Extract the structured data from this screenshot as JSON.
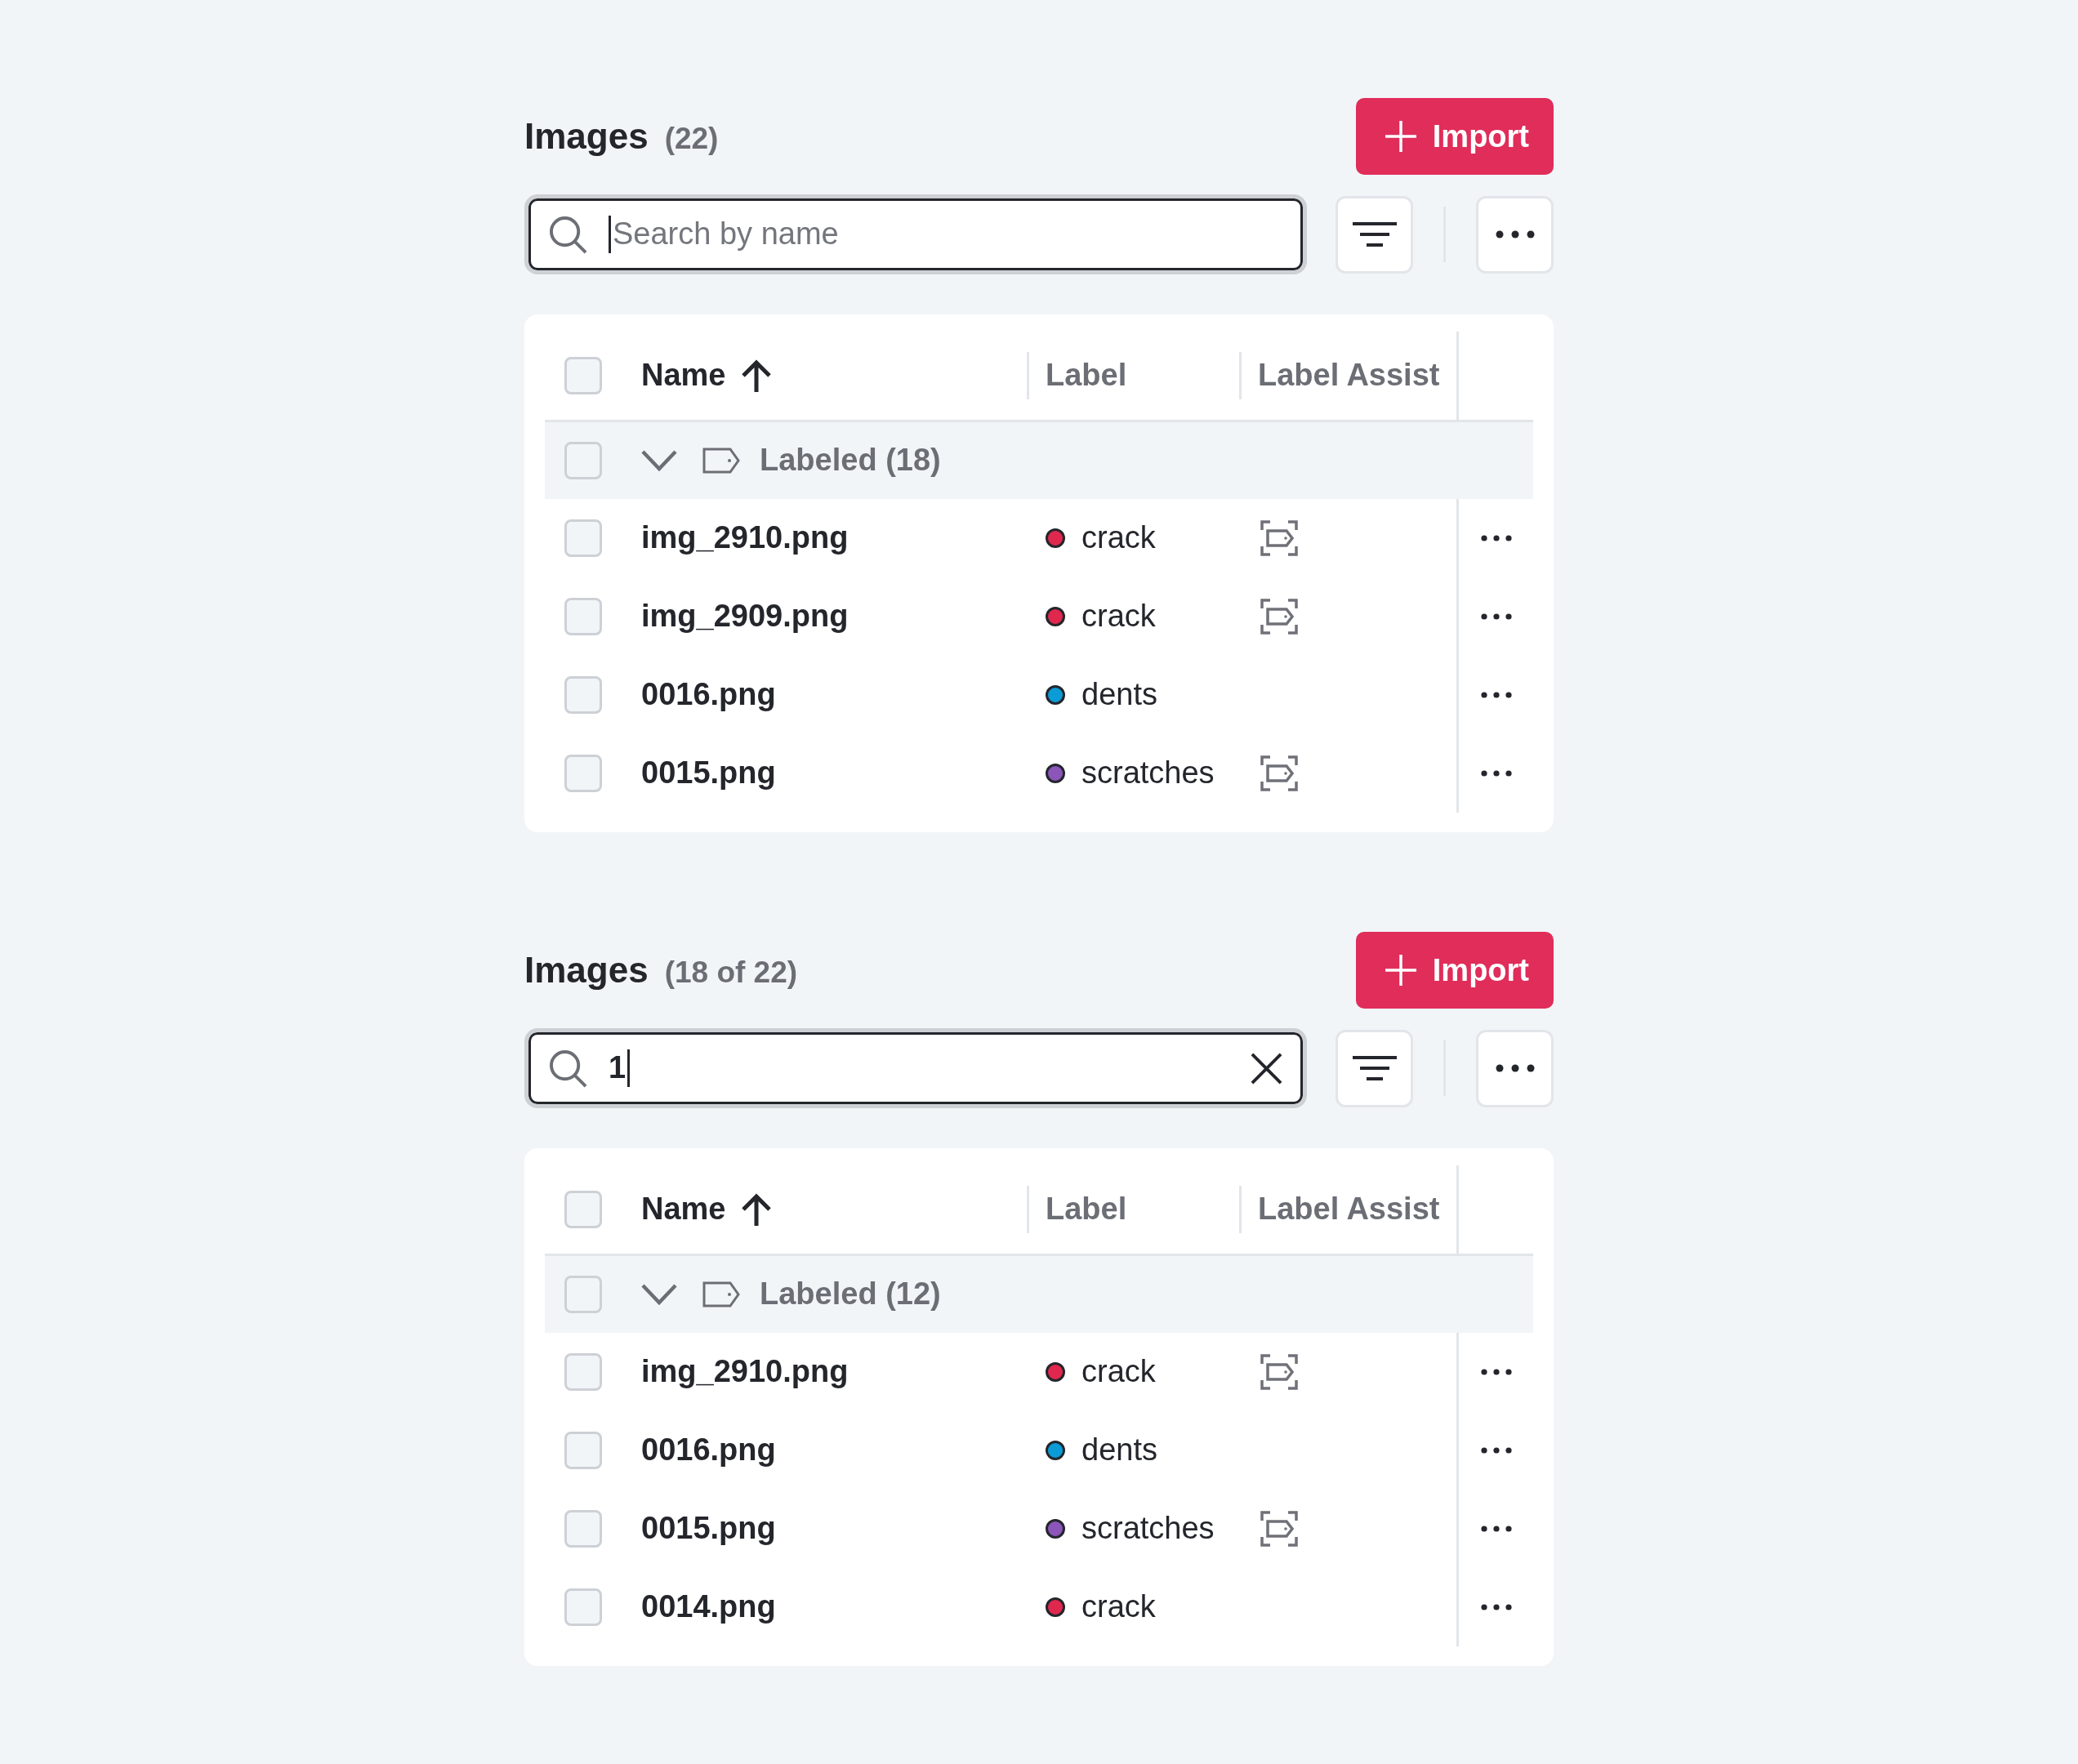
{
  "sections": [
    {
      "title": "Images",
      "count": "(22)",
      "import_button": "Import",
      "search": {
        "placeholder": "Search by name",
        "focused": true
      },
      "table": {
        "select_all": {
          "checked": false
        },
        "columns": [
          {
            "label": "Name",
            "sorted": true
          },
          {
            "label": "Label",
            "sorted": false
          },
          {
            "label": "Label Assist",
            "sorted": false
          }
        ],
        "groups": [
          {
            "label": "Labeled (18)",
            "expanded": true,
            "checked": false,
            "rows": [
              {
                "name": "img_2910.png",
                "checked": false,
                "label": "crack",
                "color": "#e0284f",
                "label_assist": true
              },
              {
                "name": "img_2909.png",
                "checked": false,
                "label": "crack",
                "color": "#e0284f",
                "label_assist": true
              },
              {
                "name": "0016.png",
                "checked": false,
                "label": "dents",
                "color": "#0b9bd6",
                "label_assist": false
              },
              {
                "name": "0015.png",
                "checked": false,
                "label": "scratches",
                "color": "#8b55b9",
                "label_assist": true
              }
            ]
          }
        ]
      }
    },
    {
      "title": "Images",
      "count": "(18 of 22)",
      "import_button": "Import",
      "search": {
        "value": "1",
        "focused": true
      },
      "table": {
        "select_all": {
          "checked": false
        },
        "columns": [
          {
            "label": "Name",
            "sorted": true
          },
          {
            "label": "Label",
            "sorted": false
          },
          {
            "label": "Label Assist",
            "sorted": false
          }
        ],
        "groups": [
          {
            "label": "Labeled (12)",
            "expanded": true,
            "checked": false,
            "rows": [
              {
                "name": "img_2910.png",
                "checked": false,
                "label": "crack",
                "color": "#e0284f",
                "label_assist": true
              },
              {
                "name": "0016.png",
                "checked": false,
                "label": "dents",
                "color": "#0b9bd6",
                "label_assist": false
              },
              {
                "name": "0015.png",
                "checked": false,
                "label": "scratches",
                "color": "#8b55b9",
                "label_assist": true
              },
              {
                "name": "0014.png",
                "checked": false,
                "label": "crack",
                "color": "#e0284f",
                "label_assist": false
              }
            ]
          }
        ]
      }
    }
  ]
}
